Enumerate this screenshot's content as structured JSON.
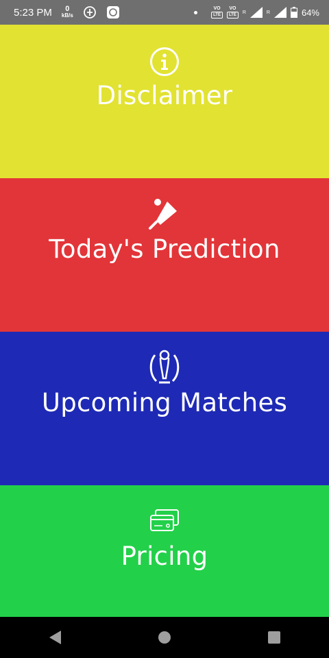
{
  "status_bar": {
    "time": "5:23 PM",
    "net_speed_value": "0",
    "net_speed_unit": "kB/s",
    "battery": "64%",
    "volte1": "VO",
    "volte1_lte": "LTE",
    "volte2": "VO",
    "volte2_lte": "LTE",
    "sim1_type": "R",
    "sim2_type": "R",
    "icons": [
      "data-saver-icon",
      "notification-app-icon",
      "dot-icon",
      "volte-icon",
      "signal-icon",
      "battery-icon"
    ]
  },
  "tiles": [
    {
      "label": "Disclaimer",
      "icon": "info-icon",
      "color": "#e2e232"
    },
    {
      "label": "Today's Prediction",
      "icon": "cricket-bat-icon",
      "color": "#e23539"
    },
    {
      "label": "Upcoming Matches",
      "icon": "trophy-icon",
      "color": "#1e2ab5"
    },
    {
      "label": "Pricing",
      "icon": "credit-card-icon",
      "color": "#23d04a"
    }
  ],
  "nav": {
    "buttons": [
      "back-icon",
      "home-icon",
      "recents-icon"
    ]
  }
}
